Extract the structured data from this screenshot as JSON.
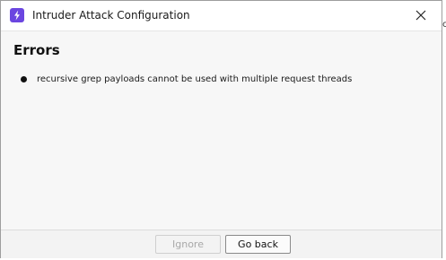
{
  "window": {
    "title": "Intruder Attack Configuration",
    "app_icon": "burp-lightning-icon",
    "accent_color": "#6b46e0"
  },
  "content": {
    "heading": "Errors",
    "errors": [
      "recursive grep payloads cannot be used with multiple request threads"
    ]
  },
  "footer": {
    "ignore_label": "Ignore",
    "ignore_enabled": false,
    "go_back_label": "Go back"
  },
  "background_edge_glyph": "c"
}
